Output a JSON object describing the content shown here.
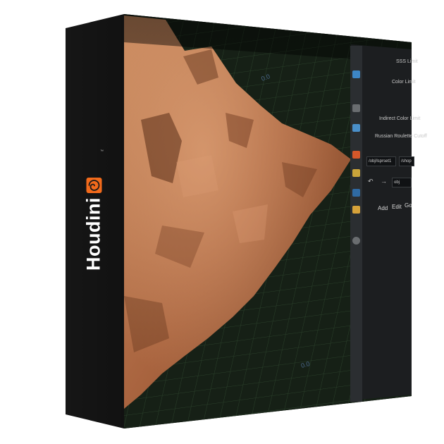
{
  "product": {
    "name": "Houdini",
    "trademark": "™",
    "logo_icon": "houdini-swirl-icon"
  },
  "panel": {
    "params": [
      "SSS Limit",
      "Color Limit",
      "Indirect Color Limit",
      "Russian Roulette Cutoff"
    ],
    "path_left": "/obj/lsprset1",
    "path_right": "/shop",
    "path_obj": "obj",
    "menu": [
      "Add",
      "Edit",
      "Go"
    ]
  },
  "viewport": {
    "labels": [
      "0.0",
      "0.0"
    ]
  },
  "colors": {
    "brand_orange": "#f26a1b",
    "box_black": "#0d0d0d",
    "grid_line": "#3b5a3b",
    "rock": "#b5714a"
  }
}
